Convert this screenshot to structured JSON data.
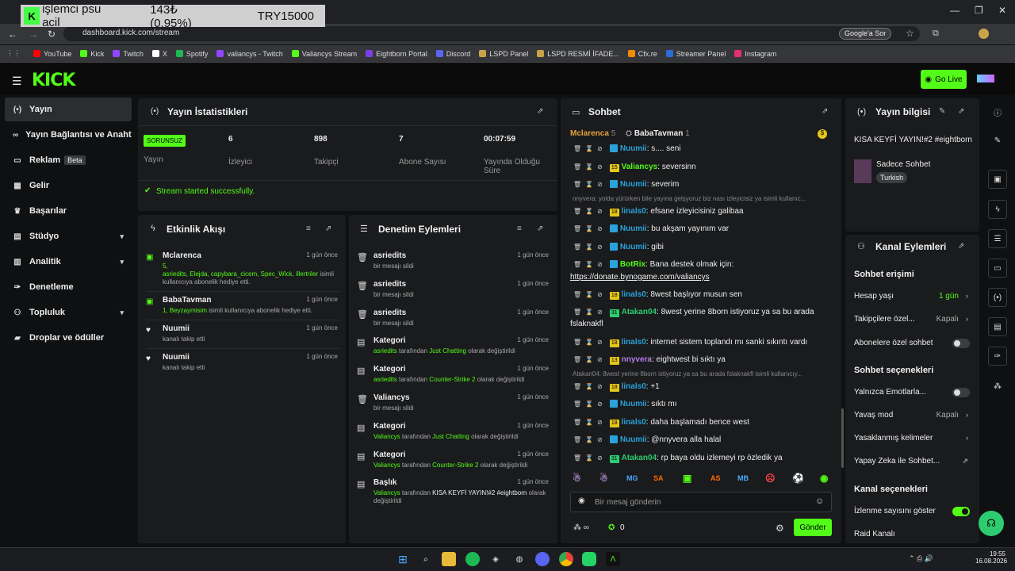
{
  "overlay": {
    "title": "işlemci psu acil",
    "amount": "143₺ (0.95%)",
    "goal": "TRY15000"
  },
  "browser": {
    "url": "dashboard.kick.com/stream",
    "google_label": "Google'a Sor",
    "bookmarks": [
      {
        "label": "YouTube",
        "color": "#ff0000"
      },
      {
        "label": "Kick",
        "color": "#53fc18"
      },
      {
        "label": "Twitch",
        "color": "#9146ff"
      },
      {
        "label": "X",
        "color": "#ffffff"
      },
      {
        "label": "Spotify",
        "color": "#1db954"
      },
      {
        "label": "valiancys - Twitch",
        "color": "#9146ff"
      },
      {
        "label": "Valiancys Stream",
        "color": "#53fc18"
      },
      {
        "label": "Eightborn Portal",
        "color": "#7b3fe4"
      },
      {
        "label": "Discord",
        "color": "#5865f2"
      },
      {
        "label": "LSPD Panel",
        "color": "#c8a34a"
      },
      {
        "label": "LSPD  RESMİ İFADE...",
        "color": "#c8a34a"
      },
      {
        "label": "Cfx.re",
        "color": "#f38b00"
      },
      {
        "label": "Streamer Panel",
        "color": "#2a6bd8"
      },
      {
        "label": "Instagram",
        "color": "#e1306c"
      }
    ]
  },
  "header": {
    "logo": "KICK",
    "go_live": "Go Live"
  },
  "sidebar": {
    "items": [
      {
        "label": "Yayın",
        "icon": "broadcast-icon"
      },
      {
        "label": "Yayın Bağlantısı ve Anahtarı",
        "icon": "link-icon"
      },
      {
        "label": "Reklam",
        "icon": "ad-icon",
        "badge": "Beta"
      },
      {
        "label": "Gelir",
        "icon": "revenue-icon"
      },
      {
        "label": "Başarılar",
        "icon": "trophy-icon"
      },
      {
        "label": "Stüdyo",
        "icon": "studio-icon"
      },
      {
        "label": "Analitik",
        "icon": "analytics-icon"
      },
      {
        "label": "Denetleme",
        "icon": "moderation-icon"
      },
      {
        "label": "Topluluk",
        "icon": "community-icon"
      },
      {
        "label": "Droplar ve ödüller",
        "icon": "drops-icon"
      }
    ]
  },
  "stats": {
    "title": "Yayın İstatistikleri",
    "status": "SORUNSUZ",
    "status_label": "Yayın",
    "viewers": "6",
    "viewers_label": "İzleyici",
    "followers": "898",
    "followers_label": "Takipçi",
    "subs": "7",
    "subs_label": "Abone Sayısı",
    "uptime": "00:07:59",
    "uptime_label": "Yayında Olduğu Süre",
    "message": "Stream started successfully."
  },
  "activity": {
    "title": "Etkinlik Akışı",
    "events": [
      {
        "user": "Mclarenca",
        "time": "1 gün önce",
        "count": "5,",
        "names": "asriedits, Elejda, capybara_cicem, Spec_Wick, illertriler",
        "text": "isimli kullanıcıya abonelik hediye etti."
      },
      {
        "user": "BabaTavman",
        "time": "1 gün önce",
        "names": "1, Beyzaymisim",
        "text": "isimli kullanıcıya abonelik hediye etti."
      },
      {
        "user": "Nuumii",
        "time": "1 gün önce",
        "text": "kanalı takip etti"
      },
      {
        "user": "Nuumii",
        "time": "1 gün önce",
        "text": "kanalı takip etti"
      }
    ]
  },
  "moderation": {
    "title": "Denetim Eylemleri",
    "actions": [
      {
        "user": "asriedits",
        "time": "1 gün önce",
        "text": "bir mesajı sildi"
      },
      {
        "user": "asriedits",
        "time": "1 gün önce",
        "text": "bir mesajı sildi"
      },
      {
        "user": "asriedits",
        "time": "1 gün önce",
        "text": "bir mesajı sildi"
      },
      {
        "user": "Kategori",
        "time": "1 gün önce",
        "who": "asriedits",
        "mid": "tarafından",
        "val": "Just Chatting",
        "end": "olarak değiştirildi"
      },
      {
        "user": "Kategori",
        "time": "1 gün önce",
        "who": "asriedits",
        "mid": "tarafından",
        "val": "Counter-Strike 2",
        "end": "olarak değiştirildi"
      },
      {
        "user": "Valiancys",
        "time": "1 gün önce",
        "text": "bir mesajı sildi"
      },
      {
        "user": "Kategori",
        "time": "1 gün önce",
        "who": "Valiancys",
        "mid": "tarafından",
        "val": "Just Chatting",
        "end": "olarak değiştirildi"
      },
      {
        "user": "Kategori",
        "time": "1 gün önce",
        "who": "Valiancys",
        "mid": "tarafından",
        "val": "Counter-Strike 2",
        "end": "olarak değiştirildi"
      },
      {
        "user": "Başlık",
        "time": "1 gün önce",
        "who": "Valiancys",
        "mid": "tarafından",
        "val": "KISA KEYFİ YAYIN!#2 #eightborn",
        "end": "olarak değiştirildi"
      }
    ]
  },
  "chat": {
    "title": "Sohbet",
    "pinned": [
      {
        "user": "Mclarenca",
        "count": "5"
      },
      {
        "user": "BabaTavman",
        "count": "1"
      }
    ],
    "messages": [
      {
        "lvl": "",
        "user": "Nuumii",
        "color": "#2aa1d8",
        "text": "s.... seni",
        "kick": true
      },
      {
        "lvl": "15",
        "user": "Valiancys",
        "color": "#53fc18",
        "text": "seversinn"
      },
      {
        "lvl": "",
        "user": "Nuumii",
        "color": "#2aa1d8",
        "text": "severim",
        "kick": true
      },
      {
        "sys": "nnyvera: yolda yürürken bile yayına gelşyoruz biz nası izleyicisiz ya isimli kullanıc..."
      },
      {
        "lvl": "18",
        "user": "linals0",
        "color": "#2aa1d8",
        "text": "efsane izleyicisiniz galibaa"
      },
      {
        "lvl": "",
        "user": "Nuumii",
        "color": "#2aa1d8",
        "text": "bu akşam yayınım var",
        "kick": true
      },
      {
        "lvl": "",
        "user": "Nuumii",
        "color": "#2aa1d8",
        "text": "gibi",
        "kick": true
      },
      {
        "lvl": "",
        "user": "BotRix",
        "color": "#53fc18",
        "text": "Bana destek olmak için:",
        "kick": true
      },
      {
        "link": "https://donate.bynogame.com/valiancys"
      },
      {
        "lvl": "18",
        "user": "linals0",
        "color": "#2aa1d8",
        "text": "8west başlıyor musun sen"
      },
      {
        "lvl": "31",
        "user": "Atakan04",
        "color": "#2ecc71",
        "text": "8west yerine 8born istiyoruz ya sa bu arada"
      },
      {
        "cont": "fslaknakfl"
      },
      {
        "lvl": "18",
        "user": "linals0",
        "color": "#2aa1d8",
        "text": "internet sistem toplandı mı sanki sıkıntı vardı"
      },
      {
        "lvl": "13",
        "user": "nnyvera",
        "color": "#b07ee8",
        "text": "eightwest bi sıktı ya"
      },
      {
        "sys": "Atakan04: 8west yerine 8born istiyoruz ya sa bu arada fslaknakfl isimli kullanıcıy..."
      },
      {
        "lvl": "18",
        "user": "linals0",
        "color": "#2aa1d8",
        "text": "+1"
      },
      {
        "lvl": "",
        "user": "Nuumii",
        "color": "#2aa1d8",
        "text": "sıktı mı",
        "kick": true
      },
      {
        "lvl": "18",
        "user": "linals0",
        "color": "#2aa1d8",
        "text": "daha başlamadı bence west"
      },
      {
        "lvl": "",
        "user": "Nuumii",
        "color": "#2aa1d8",
        "text": "@nnyvera alla halal",
        "kick": true
      },
      {
        "lvl": "31",
        "user": "Atakan04",
        "color": "#2ecc71",
        "text": "rp baya oldu izlemeyi rp özledik ya"
      }
    ],
    "emotes": [
      "MG",
      "SA",
      "AS",
      "MB"
    ],
    "placeholder": "Bir mesaj gönderin",
    "points": "0",
    "send": "Gönder"
  },
  "info": {
    "title": "Yayın bilgisi",
    "stream_title": "KISA KEYFİ YAYIN!#2 #eightborn",
    "category": "Sadece Sohbet",
    "language": "Turkish"
  },
  "actions": {
    "title": "Kanal Eylemleri",
    "chat_access": "Sohbet erişimi",
    "account_age": "Hesap yaşı",
    "account_age_val": "1 gün",
    "followers_only": "Takipçilere özel...",
    "followers_only_val": "Kapalı",
    "subs_only": "Abonelere özel sohbet",
    "chat_options": "Sohbet seçenekleri",
    "emotes_only": "Yalnızca Emotlarla...",
    "slow_mode": "Yavaş mod",
    "slow_mode_val": "Kapalı",
    "banned_words": "Yasaklanmış kelimeler",
    "ai_chat": "Yapay Zeka ile Sohbet...",
    "channel_options": "Kanal seçenekleri",
    "show_viewers": "İzlenme sayısını göster",
    "raid": "Raid Kanalı"
  },
  "taskbar": {
    "time": "19:55",
    "date": "16.08.2026"
  }
}
